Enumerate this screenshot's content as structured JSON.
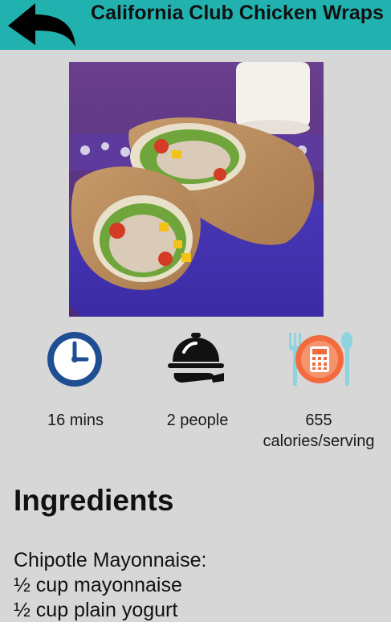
{
  "header": {
    "title": "California Club Chicken Wraps",
    "back_icon": "back-arrow-icon",
    "background_color": "#21b2b0"
  },
  "hero": {
    "icon": "recipe-photo"
  },
  "stats": [
    {
      "icon": "clock-icon",
      "text": "16 mins"
    },
    {
      "icon": "serving-cloche-icon",
      "text": "2 people"
    },
    {
      "icon": "calorie-calculator-icon",
      "text": "655\ncalories/serving"
    }
  ],
  "ingredients": {
    "heading": "Ingredients",
    "items": [
      "Chipotle Mayonnaise:",
      "½ cup mayonnaise",
      "½ cup plain yogurt"
    ]
  }
}
